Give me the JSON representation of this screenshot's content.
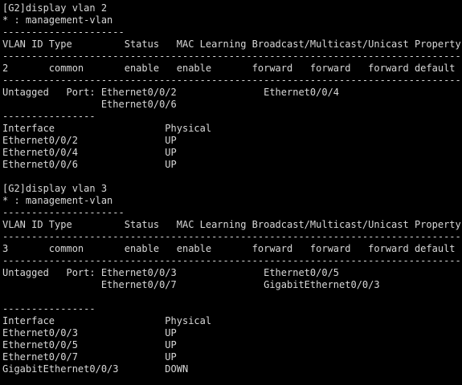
{
  "terminal": {
    "lines": [
      "[G2]display vlan 2",
      "* : management-vlan",
      "---------------------",
      "VLAN ID Type         Status   MAC Learning Broadcast/Multicast/Unicast Property",
      "--------------------------------------------------------------------------------",
      "2       common       enable   enable       forward   forward   forward default",
      "--------------------------------------------------------------------------------",
      "Untagged   Port: Ethernet0/0/2               Ethernet0/0/4",
      "                 Ethernet0/0/6",
      "----------------",
      "Interface                   Physical",
      "Ethernet0/0/2               UP",
      "Ethernet0/0/4               UP",
      "Ethernet0/0/6               UP",
      "",
      "[G2]display vlan 3",
      "* : management-vlan",
      "---------------------",
      "VLAN ID Type         Status   MAC Learning Broadcast/Multicast/Unicast Property",
      "--------------------------------------------------------------------------------",
      "3       common       enable   enable       forward   forward   forward default",
      "--------------------------------------------------------------------------------",
      "Untagged   Port: Ethernet0/0/3               Ethernet0/0/5",
      "                 Ethernet0/0/7               GigabitEthernet0/0/3",
      "",
      "----------------",
      "Interface                   Physical",
      "Ethernet0/0/3               UP",
      "Ethernet0/0/5               UP",
      "Ethernet0/0/7               UP",
      "GigabitEthernet0/0/3        DOWN"
    ]
  }
}
